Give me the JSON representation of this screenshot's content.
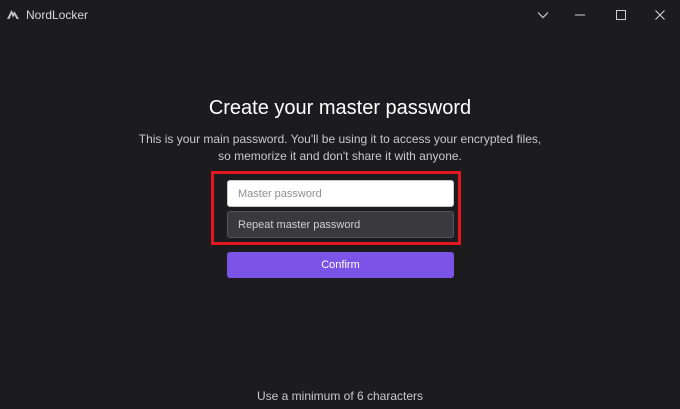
{
  "titlebar": {
    "app_title": "NordLocker",
    "icons": [
      "nordlocker-logo-icon",
      "chevron-down-icon",
      "minimize-icon",
      "maximize-icon",
      "close-icon"
    ]
  },
  "main": {
    "heading": "Create your master password",
    "subtitle_line1": "This is your main password. You'll be using it to access your encrypted files,",
    "subtitle_line2": "so memorize it and don't share it with anyone.",
    "master_password": {
      "placeholder": "Master password",
      "value": ""
    },
    "repeat_password": {
      "placeholder": "Repeat master password",
      "value": ""
    },
    "confirm_label": "Confirm",
    "hint": "Use a minimum of 6 characters"
  },
  "colors": {
    "background": "#1c1c1f",
    "accent": "#7b53e6",
    "highlight": "#e3161f"
  }
}
